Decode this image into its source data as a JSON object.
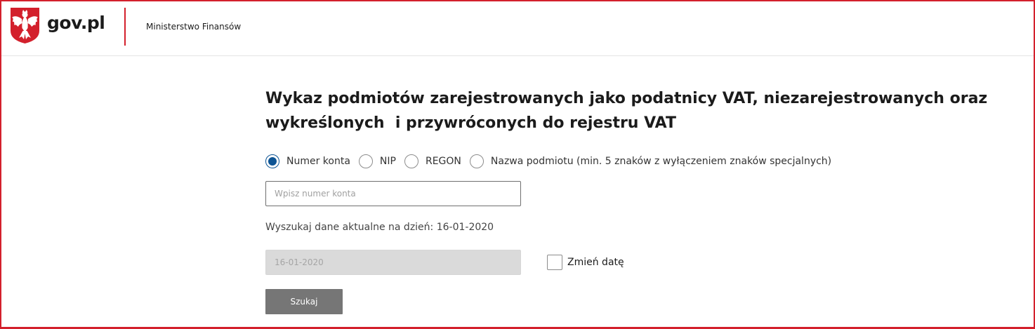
{
  "header": {
    "logo_text": "gov.pl",
    "ministry": "Ministerstwo Finansów",
    "brand_color": "#d3202c"
  },
  "title_line1": "Wykaz podmiotów zarejestrowanych jako podatnicy VAT, niezarejestrowanych oraz",
  "title_line2": "wykreślonych  i przywróconych do rejestru VAT",
  "search_by": {
    "options": [
      {
        "label": "Numer konta",
        "checked": true
      },
      {
        "label": "NIP",
        "checked": false
      },
      {
        "label": "REGON",
        "checked": false
      },
      {
        "label": "Nazwa podmiotu (min. 5 znaków z wyłączeniem znaków specjalnych)",
        "checked": false
      }
    ],
    "selected_color": "#0d5494"
  },
  "account_input": {
    "placeholder": "Wpisz numer konta",
    "value": ""
  },
  "date_caption": "Wyszukaj dane aktualne na dzień: 16-01-2020",
  "date_input": {
    "value": "16-01-2020",
    "disabled": true
  },
  "change_date": {
    "label": "Zmień datę",
    "checked": false
  },
  "search_button": {
    "label": "Szukaj"
  }
}
